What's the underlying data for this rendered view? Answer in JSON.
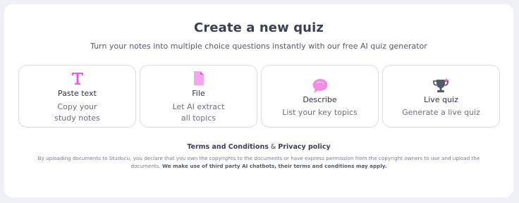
{
  "header": {
    "title": "Create a new quiz",
    "subtitle": "Turn your notes into multiple choice questions instantly with our free AI quiz generator"
  },
  "cards": [
    {
      "icon": "text-icon",
      "label": "Paste text",
      "desc_line1": "Copy your",
      "desc_line2": "study notes"
    },
    {
      "icon": "file-icon",
      "label": "File",
      "desc_line1": "Let AI extract",
      "desc_line2": "all topics"
    },
    {
      "icon": "chat-bubble-icon",
      "label": "Describe",
      "desc_line1": "List your key topics"
    },
    {
      "icon": "trophy-icon",
      "label": "Live quiz",
      "desc_line1": "Generate a live quiz"
    }
  ],
  "footer": {
    "terms_label": "Terms and Conditions",
    "ampersand": "&",
    "privacy_label": "Privacy policy",
    "disclaimer_text": "By uploading documents to Studocu, you declare that you own the copyrights to the documents or have express permission from the copyright owners to use and upload the documents.",
    "disclaimer_bold": "We make use of third party AI chatbots, their terms and conditions may apply."
  },
  "colors": {
    "accent_pink": "#e55be0",
    "text_dark": "#3b3f52",
    "text_muted": "#6b6f80",
    "border": "#dadde6",
    "background": "#eef0f6"
  }
}
